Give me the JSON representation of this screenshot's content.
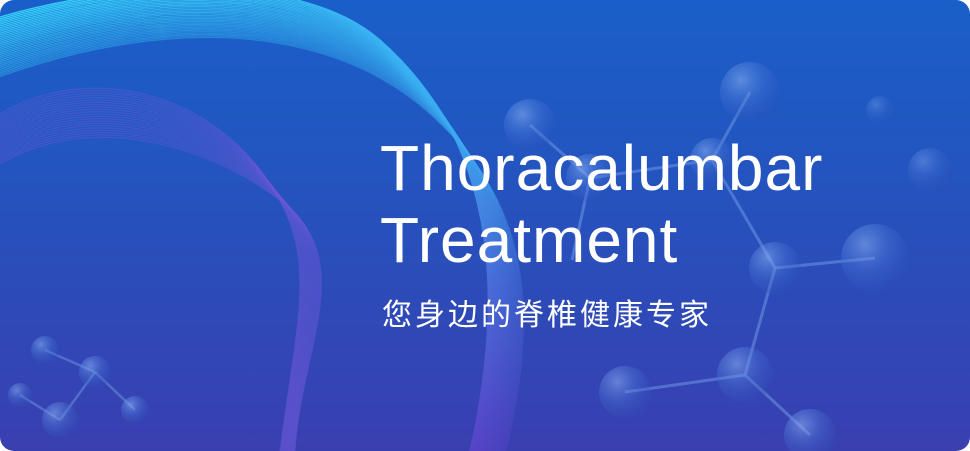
{
  "banner": {
    "title_line1": "Thoracalumbar",
    "title_line2": "Treatment",
    "subtitle": "您身边的脊椎健康专家"
  },
  "colors": {
    "background_top": "#1a5fc9",
    "background_bottom": "#3a3fb0",
    "wave_light": "#38e0ff",
    "wave_dark": "#5a3fc8",
    "text": "#ffffff"
  },
  "icons": [
    "molecule-graphic",
    "wave-lines-graphic"
  ]
}
